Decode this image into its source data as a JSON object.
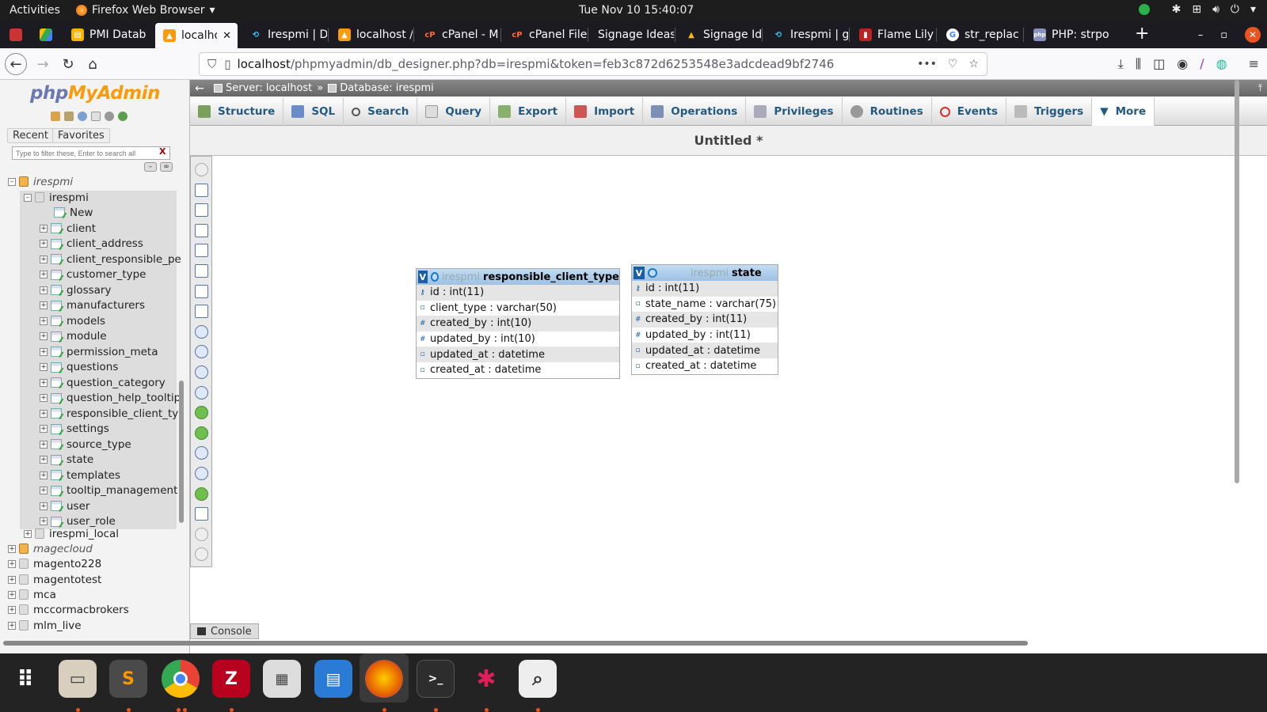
{
  "system": {
    "activities": "Activities",
    "app_name": "Firefox Web Browser",
    "clock": "Tue Nov 10  15:40:07"
  },
  "browser": {
    "tabs": [
      {
        "label": "PMI Datab",
        "favicon": "pmi-icon"
      },
      {
        "label": "localho",
        "favicon": "phpmyadmin-icon",
        "active": true
      },
      {
        "label": "Irespmi | D",
        "favicon": "irespmi-icon"
      },
      {
        "label": "localhost /",
        "favicon": "phpmyadmin-icon"
      },
      {
        "label": "cPanel - M",
        "favicon": "cpanel-icon"
      },
      {
        "label": "cPanel File",
        "favicon": "cpanel-icon"
      },
      {
        "label": "Signage Ideas",
        "favicon": ""
      },
      {
        "label": "Signage Id",
        "favicon": "drive-icon"
      },
      {
        "label": "Irespmi | g",
        "favicon": "irespmi-icon"
      },
      {
        "label": "Flame Lily",
        "favicon": "flame-icon"
      },
      {
        "label": "str_replac",
        "favicon": "google-icon"
      },
      {
        "label": "PHP: strpo",
        "favicon": "php-icon"
      }
    ],
    "url_host": "localhost",
    "url_rest": "/phpmyadmin/db_designer.php?db=irespmi&token=feb3c872d6253548e3adcdead9bf2746"
  },
  "pma": {
    "logo_php": "php",
    "logo_myadmin": "MyAdmin",
    "recent": "Recent",
    "favorites": "Favorites",
    "filter_placeholder": "Type to filter these, Enter to search all",
    "filter_clear": "X",
    "tree": {
      "root_irespmi": "irespmi",
      "db_irespmi": "irespmi",
      "new": "New",
      "tables": [
        "client",
        "client_address",
        "client_responsible_pe",
        "customer_type",
        "glossary",
        "manufacturers",
        "models",
        "module",
        "permission_meta",
        "questions",
        "question_category",
        "question_help_tooltip",
        "responsible_client_ty",
        "settings",
        "source_type",
        "state",
        "templates",
        "tooltip_management",
        "user",
        "user_role"
      ],
      "irespmi_local": "irespmi_local",
      "magecloud": "magecloud",
      "others": [
        "magento228",
        "magentotest",
        "mca",
        "mccormacbrokers",
        "mlm_live"
      ]
    },
    "breadcrumb": {
      "server": "Server: localhost",
      "sep": "»",
      "database": "Database: irespmi"
    },
    "menu": [
      "Structure",
      "SQL",
      "Search",
      "Query",
      "Export",
      "Import",
      "Operations",
      "Privileges",
      "Routines",
      "Events",
      "Triggers",
      "More"
    ],
    "designer_title": "Untitled *",
    "console": "Console"
  },
  "designer": {
    "tables": [
      {
        "db": "irespmi",
        "name": "responsible_client_type",
        "columns": [
          "id : int(11)",
          "client_type : varchar(50)",
          "created_by : int(10)",
          "updated_by : int(10)",
          "updated_at : datetime",
          "created_at : datetime"
        ]
      },
      {
        "db": "irespmi",
        "name": "state",
        "columns": [
          "id : int(11)",
          "state_name : varchar(75)",
          "created_by : int(11)",
          "updated_by : int(11)",
          "updated_at : datetime",
          "created_at : datetime"
        ]
      }
    ]
  },
  "colors": {
    "ubuntu_orange": "#e95420",
    "pma_link": "#235a81",
    "designer_header": "#9cc1e6"
  }
}
